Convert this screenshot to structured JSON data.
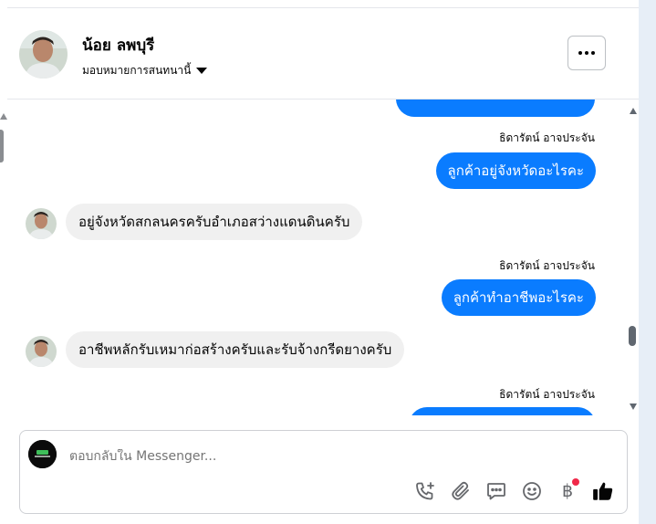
{
  "header": {
    "contact_name": "น้อย ลพบุรี",
    "assign_label": "มอบหมายการสนทนานี้"
  },
  "thread": {
    "sender_name": "ธิดารัตน์ อาจประจัน",
    "messages": [
      {
        "direction": "out",
        "text": "ลูกค้าอยู่จังหวัดอะไรคะ"
      },
      {
        "direction": "in",
        "text": "อยู่จังหวัดสกลนครครับอำเภอสว่างแดนดินครับ"
      },
      {
        "direction": "out",
        "text": "ลูกค้าทำอาชีพอะไรคะ"
      },
      {
        "direction": "in",
        "text": "อาชีพหลักรับเหมาก่อสร้างครับและรับจ้างกรีดยางครับ"
      }
    ]
  },
  "composer": {
    "placeholder": "ตอบกลับใน Messenger...",
    "baht_symbol": "฿"
  },
  "colors": {
    "outgoing_bubble": "#0a7cff",
    "incoming_bubble": "#f0f0f0",
    "notification_dot": "#f02849",
    "side_panel": "#e7eef7"
  }
}
